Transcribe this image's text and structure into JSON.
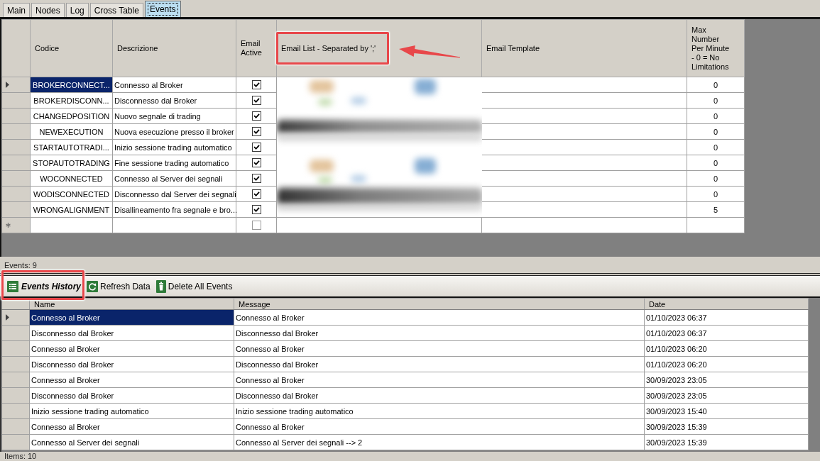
{
  "tabs": [
    {
      "label": "Main",
      "selected": false
    },
    {
      "label": "Nodes",
      "selected": false
    },
    {
      "label": "Log",
      "selected": false
    },
    {
      "label": "Cross Table",
      "selected": false
    },
    {
      "label": "Events",
      "selected": true
    }
  ],
  "events_grid": {
    "columns": [
      "Codice",
      "Descrizione",
      "Email Active",
      "Email List - Separated by ';'",
      "Email Template",
      "Max Number Per Minute - 0 = No Limitations"
    ],
    "rows": [
      {
        "codice": "BROKERCONNECT...",
        "descrizione": "Connesso al Broker",
        "email_active": true,
        "max_per_minute": "0",
        "selected": true
      },
      {
        "codice": "BROKERDISCONN...",
        "descrizione": "Disconnesso dal Broker",
        "email_active": true,
        "max_per_minute": "0",
        "selected": false
      },
      {
        "codice": "CHANGEDPOSITION",
        "descrizione": "Nuovo segnale di trading",
        "email_active": true,
        "max_per_minute": "0",
        "selected": false
      },
      {
        "codice": "NEWEXECUTION",
        "descrizione": "Nuova esecuzione presso il broker",
        "email_active": true,
        "max_per_minute": "0",
        "selected": false
      },
      {
        "codice": "STARTAUTOTRADI...",
        "descrizione": "Inizio sessione trading automatico",
        "email_active": true,
        "max_per_minute": "0",
        "selected": false
      },
      {
        "codice": "STOPAUTOTRADING",
        "descrizione": "Fine sessione trading automatico",
        "email_active": true,
        "max_per_minute": "0",
        "selected": false
      },
      {
        "codice": "WOCONNECTED",
        "descrizione": "Connesso al Server dei segnali",
        "email_active": true,
        "max_per_minute": "0",
        "selected": false
      },
      {
        "codice": "WODISCONNECTED",
        "descrizione": "Disconnesso dal Server dei segnali",
        "email_active": true,
        "max_per_minute": "0",
        "selected": false
      },
      {
        "codice": "WRONGALIGNMENT",
        "descrizione": "Disallineamento fra segnale e bro...",
        "email_active": true,
        "max_per_minute": "5",
        "selected": false
      }
    ],
    "new_row": {
      "email_active": false
    }
  },
  "events_count": "Events: 9",
  "toolbar": [
    {
      "label": "Events History",
      "kind": "title"
    },
    {
      "label": "Refresh Data",
      "kind": "refresh"
    },
    {
      "label": "Delete All Events",
      "kind": "delete"
    }
  ],
  "history_grid": {
    "columns": [
      "Name",
      "Message",
      "Date"
    ],
    "rows": [
      {
        "name": "Connesso al Broker",
        "message": "Connesso al Broker",
        "date": "01/10/2023 06:37",
        "selected": true
      },
      {
        "name": "Disconnesso dal Broker",
        "message": "Disconnesso dal Broker",
        "date": "01/10/2023 06:37",
        "selected": false
      },
      {
        "name": "Connesso al Broker",
        "message": "Connesso al Broker",
        "date": "01/10/2023 06:20",
        "selected": false
      },
      {
        "name": "Disconnesso dal Broker",
        "message": "Disconnesso dal Broker",
        "date": "01/10/2023 06:20",
        "selected": false
      },
      {
        "name": "Connesso al Broker",
        "message": "Connesso al Broker",
        "date": "30/09/2023 23:05",
        "selected": false
      },
      {
        "name": "Disconnesso dal Broker",
        "message": "Disconnesso dal Broker",
        "date": "30/09/2023 23:05",
        "selected": false
      },
      {
        "name": "Inizio sessione trading automatico",
        "message": "Inizio sessione trading automatico",
        "date": "30/09/2023 15:40",
        "selected": false
      },
      {
        "name": "Connesso al Broker",
        "message": "Connesso al Broker",
        "date": "30/09/2023 15:39",
        "selected": false
      },
      {
        "name": "Connesso al Server dei segnali",
        "message": "Connesso al Server dei segnali --> 2",
        "date": "30/09/2023 15:39",
        "selected": false
      }
    ]
  },
  "items_count": "Items: 10"
}
